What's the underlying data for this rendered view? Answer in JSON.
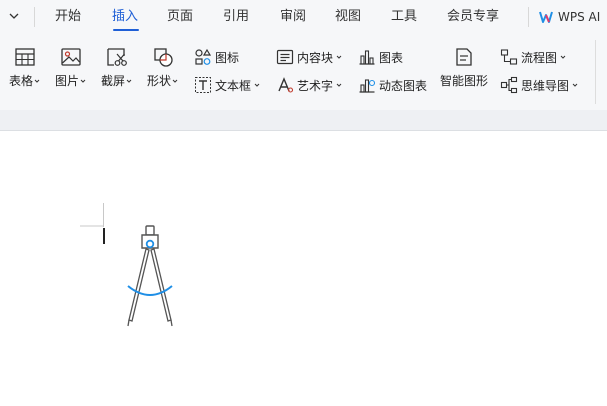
{
  "tabs": [
    {
      "label": "开始"
    },
    {
      "label": "插入"
    },
    {
      "label": "页面"
    },
    {
      "label": "引用"
    },
    {
      "label": "审阅"
    },
    {
      "label": "视图"
    },
    {
      "label": "工具"
    },
    {
      "label": "会员专享"
    }
  ],
  "active_tab": "插入",
  "wps_ai": {
    "label": "WPS AI"
  },
  "ribbon": {
    "table": "表格",
    "picture": "图片",
    "screenshot": "截屏",
    "shape": "形状",
    "icon": "图标",
    "textbox": "文本框",
    "content_block": "内容块",
    "wordart": "艺术字",
    "chart": "图表",
    "dynamic_chart": "动态图表",
    "smartart": "智能图形",
    "flowchart": "流程图",
    "mindmap": "思维导图"
  },
  "icons": {
    "collapse": "chevron-down-icon",
    "ai": "wps-ai-logo-icon",
    "compass": "compass-illustration"
  },
  "colors": {
    "accent": "#1f5fd6",
    "ai_blue": "#1f8fe6"
  }
}
